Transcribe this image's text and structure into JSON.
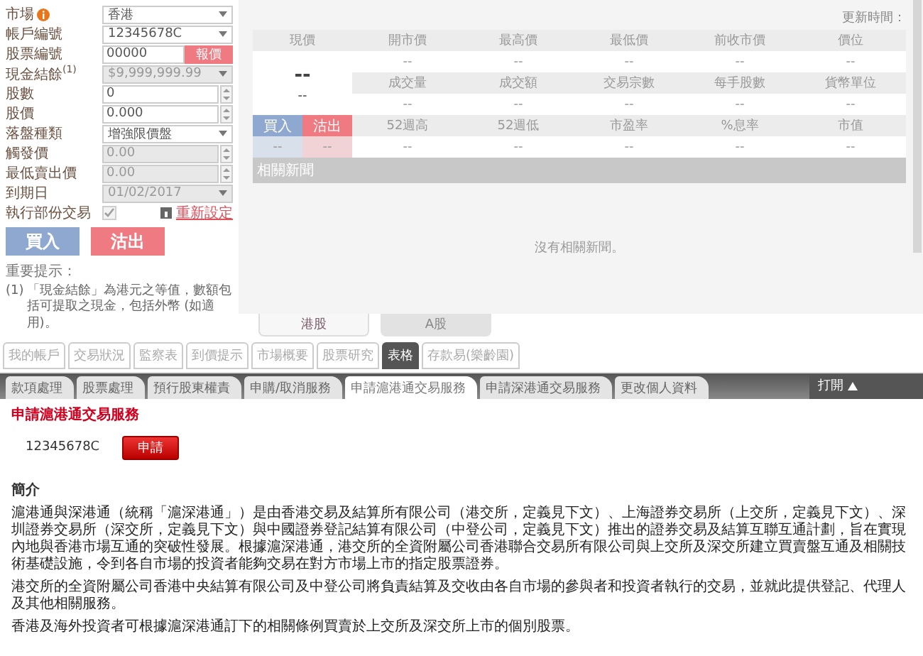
{
  "order_form": {
    "fields": [
      {
        "label": "市場",
        "info": true,
        "kind": "select",
        "value": "香港",
        "disabled": false
      },
      {
        "label": "帳戶編號",
        "kind": "select",
        "value": "12345678C",
        "disabled": false
      },
      {
        "label": "股票編號",
        "kind": "text",
        "value": "00000",
        "button": "報價",
        "disabled": false
      },
      {
        "label": "現金結餘$^{(1)}$",
        "kind": "select",
        "value": "$9,999,999.99",
        "disabled": true
      },
      {
        "label": "股數",
        "kind": "spin",
        "value": "0",
        "disabled": false
      },
      {
        "label": "股價",
        "kind": "spin",
        "value": "0.000",
        "disabled": false
      },
      {
        "label": "落盤種類",
        "kind": "select",
        "value": "增強限價盤",
        "disabled": false
      },
      {
        "label": "觸發價",
        "kind": "spin",
        "value": "0.00",
        "disabled": true
      },
      {
        "label": "最低賣出價",
        "kind": "spin",
        "value": "0.00",
        "disabled": true
      },
      {
        "label": "到期日",
        "kind": "select",
        "value": "01/02/2017",
        "disabled": true
      },
      {
        "label": "執行部份交易",
        "kind": "check",
        "checked": true,
        "disabled": true,
        "link": "重新設定"
      }
    ],
    "buttons": [
      {
        "label": "買入",
        "kind": "buy"
      },
      {
        "label": "沽出",
        "kind": "sell"
      }
    ],
    "notes_title": "重要提示：",
    "notes": [
      {
        "mark": "(1)",
        "text": "「現金結餘」為港元之等值，數額包括可提取之現金，包括外幣 (如適用)。"
      }
    ]
  },
  "quote": {
    "update_label": "更新時間：",
    "price_label": "現價",
    "price": "--",
    "change": "--",
    "stats": [
      [
        {
          "label": "開市價",
          "value": "--"
        },
        {
          "label": "最高價",
          "value": "--"
        },
        {
          "label": "最低價",
          "value": "--"
        },
        {
          "label": "前收市價",
          "value": "--"
        },
        {
          "label": "價位",
          "value": "--"
        }
      ],
      [
        {
          "label": "成交量",
          "value": "--"
        },
        {
          "label": "成交額",
          "value": "--"
        },
        {
          "label": "交易宗數",
          "value": "--"
        },
        {
          "label": "每手股數",
          "value": "--"
        },
        {
          "label": "貨幣單位",
          "value": "--"
        }
      ],
      [
        {
          "label": "52週高",
          "value": "--"
        },
        {
          "label": "52週低",
          "value": "--"
        },
        {
          "label": "市盈率",
          "value": "--"
        },
        {
          "label": "%息率",
          "value": "--"
        },
        {
          "label": "市值",
          "value": "--"
        }
      ]
    ],
    "bid_ask": [
      {
        "label": "買入",
        "value": "--",
        "kind": "buy"
      },
      {
        "label": "沽出",
        "value": "--",
        "kind": "sell"
      }
    ],
    "news_title": "相關新聞",
    "news_empty": "沒有相關新聞。",
    "market_tabs": [
      {
        "label": "港股",
        "selected": true
      },
      {
        "label": "A股",
        "selected": false
      }
    ]
  },
  "nav_tabs": [
    {
      "label": "我的帳戶",
      "selected": false
    },
    {
      "label": "交易狀況",
      "selected": false
    },
    {
      "label": "監察表",
      "selected": false
    },
    {
      "label": "到價提示",
      "selected": false
    },
    {
      "label": "市場概要",
      "selected": false
    },
    {
      "label": "股票研究",
      "selected": false
    },
    {
      "label": "表格",
      "selected": true
    },
    {
      "label": "存款易(樂齡園)",
      "selected": false
    }
  ],
  "sub_tabs": [
    {
      "label": "款項處理",
      "selected": false
    },
    {
      "label": "股票處理",
      "selected": false
    },
    {
      "label": "預行股東權責",
      "selected": false
    },
    {
      "label": "申購/取消服務",
      "selected": false
    },
    {
      "label": "申請滬港通交易服務",
      "selected": true
    },
    {
      "label": "申請深港通交易服務",
      "selected": false
    },
    {
      "label": "更改個人資料",
      "selected": false
    }
  ],
  "toggle": {
    "label": "打開",
    "expanded": false
  },
  "service": {
    "title": "申請滬港通交易服務",
    "account": "12345678C",
    "button": "申請",
    "intro_title": "簡介",
    "paragraphs": [
      "滬港通與深港通（統稱「滬深港通」）是由香港交易及結算所有限公司（港交所，定義見下文）、上海證券交易所（上交所，定義見下文）、深圳證券交易所（深交所，定義見下文）與中國證券登記結算有限公司（中登公司，定義見下文）推出的證券交易及結算互聯互通計劃，旨在實現內地與香港市場互通的突破性發展。根據滬深港通，港交所的全資附屬公司香港聯合交易所有限公司與上交所及深交所建立買賣盤互通及相關技術基礎設施，令到各自市場的投資者能夠交易在對方市場上市的指定股票證券。",
      "港交所的全資附屬公司香港中央結算有限公司及中登公司將負責結算及交收由各自市場的參與者和投資者執行的交易，並就此提供登記、代理人及其他相關服務。",
      "香港及海外投資者可根據滬深港通訂下的相關條例買賣於上交所及深交所上市的個別股票。"
    ]
  }
}
